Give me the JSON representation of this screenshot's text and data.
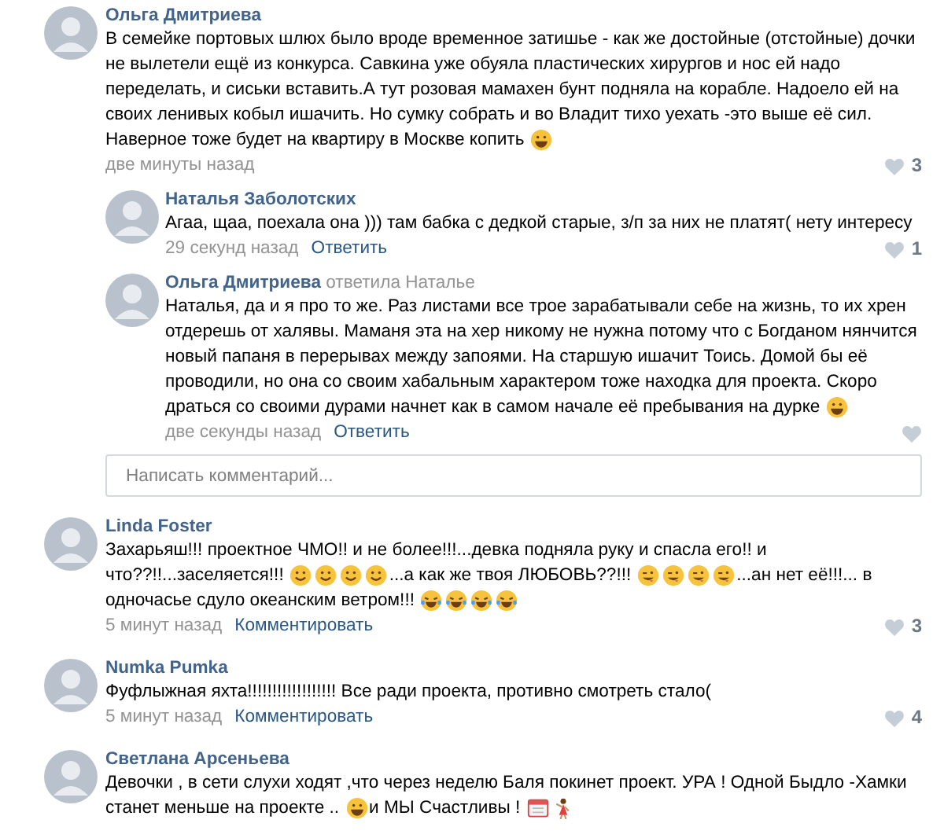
{
  "comments": [
    {
      "author": "Ольга Дмитриева",
      "body": [
        {
          "kind": "text",
          "text": "В семейке портовых шлюх было вроде временное затишье - как же достойные (отстойные) дочки не вылетели ещё из конкурса. Савкина уже обуяла пластических хирургов и нос ей надо переделать, и сиськи вставить.А тут розовая мамахен бунт подняла на корабле. Надоело ей на своих ленивых кобыл ишачить. Но сумку собрать и во Владит тихо уехать -это выше её сил."
        },
        {
          "kind": "text",
          "text": "Наверное тоже будет на квартиру в Москве копить"
        },
        {
          "kind": "grin"
        }
      ],
      "time": "две минуты назад",
      "likes": "3",
      "replies": [
        {
          "author": "Наталья Заболотских",
          "body": [
            {
              "kind": "text",
              "text": "Агаа, щаа, поехала она ))) там бабка с дедкой старые, з/п за них не платят( нету интересу"
            }
          ],
          "time": "29 секунд назад",
          "action": "Ответить",
          "likes": "1"
        },
        {
          "author": "Ольга Дмитриева",
          "reply_to": "ответила Наталье",
          "body": [
            {
              "kind": "text",
              "text": "Наталья, да и я про то же. Раз листами все трое зарабатывали себе на жизнь, то их хрен отдерешь от халявы. Маманя эта на хер никому не нужна потому что с Богданом нянчится новый папаня в перерывах между запоями. На старшую ишачит Тоись. Домой бы её проводили, но она со своим хабальным характером тоже находка для проекта. Скоро"
            },
            {
              "kind": "text",
              "text": "драться со своими дурами начнет как в самом начале её пребывания на дурке"
            },
            {
              "kind": "grin"
            }
          ],
          "time": "две секунды назад",
          "action": "Ответить"
        }
      ],
      "reply_box": {
        "placeholder": "Написать комментарий..."
      }
    },
    {
      "author": "Linda Foster",
      "body": [
        {
          "kind": "text",
          "text": "Захарьяш!!! проектное ЧМО!! и не более!!!...девка подняла руку и спасла его!! и"
        },
        {
          "kind": "text",
          "text": "что??!!...заселяется!!!"
        },
        {
          "kind": "smile"
        },
        {
          "kind": "smile"
        },
        {
          "kind": "smile"
        },
        {
          "kind": "smile"
        },
        {
          "kind": "text",
          "text": "...а как же твоя ЛЮБОВЬ??!!!"
        },
        {
          "kind": "wink"
        },
        {
          "kind": "wink"
        },
        {
          "kind": "wink"
        },
        {
          "kind": "wink"
        },
        {
          "kind": "text",
          "text": "...ан нет её!!!... в"
        },
        {
          "kind": "text",
          "text": "одночасье сдуло океанским ветром!!!"
        },
        {
          "kind": "tears"
        },
        {
          "kind": "tears"
        },
        {
          "kind": "tears"
        },
        {
          "kind": "tears"
        }
      ],
      "time": "5 минут назад",
      "action": "Комментировать",
      "likes": "3"
    },
    {
      "author": "Numka Pumka",
      "body": [
        {
          "kind": "text",
          "text": "Фуфлыжная яхта!!!!!!!!!!!!!!!!!! Все ради проекта, противно смотреть стало("
        }
      ],
      "time": "5 минут назад",
      "action": "Комментировать",
      "likes": "4"
    },
    {
      "author": "Светлана Арсеньева",
      "body": [
        {
          "kind": "text",
          "text": "Девочки , в сети слухи ходят ,что через неделю Баля покинет проект. УРА ! Одной Быдло -Хамки"
        },
        {
          "kind": "text",
          "text": "станет меньше на проекте .."
        },
        {
          "kind": "grin"
        },
        {
          "kind": "text",
          "text": "и МЫ Счастливы !"
        },
        {
          "kind": "calendar"
        },
        {
          "kind": "dancer"
        }
      ]
    }
  ]
}
